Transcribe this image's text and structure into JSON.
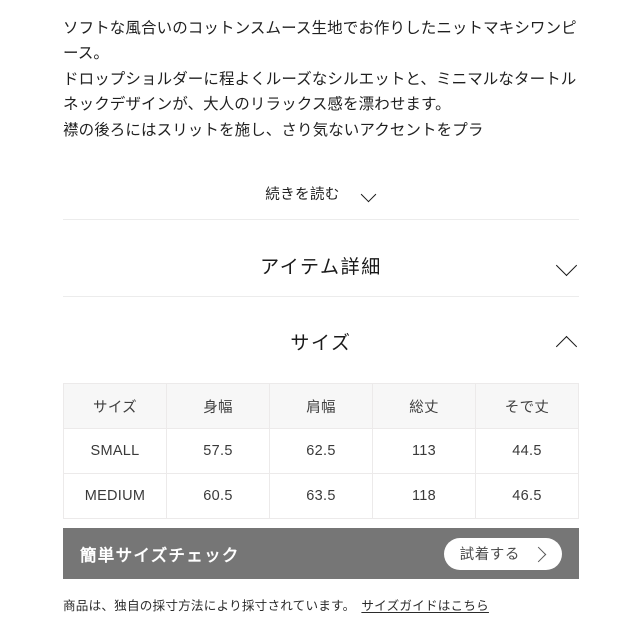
{
  "description": {
    "body": "ソフトな風合いのコットンスムース生地でお作りしたニットマキシワンピース。\nドロップショルダーに程よくルーズなシルエットと、ミニマルなタートルネックデザインが、大人のリラックス感を漂わせます。\n襟の後ろにはスリットを施し、さり気ないアクセントをプラ",
    "read_more_label": "続きを読む",
    "read_more_icon": "chevron-down-icon"
  },
  "accordions": [
    {
      "title": "アイテム詳細",
      "expanded": false,
      "icon": "chevron-down-icon"
    },
    {
      "title": "サイズ",
      "expanded": true,
      "icon": "chevron-up-icon"
    }
  ],
  "size_table": {
    "headers": [
      "サイズ",
      "身幅",
      "肩幅",
      "総丈",
      "そで丈"
    ],
    "rows": [
      [
        "SMALL",
        "57.5",
        "62.5",
        "113",
        "44.5"
      ],
      [
        "MEDIUM",
        "60.5",
        "63.5",
        "118",
        "46.5"
      ]
    ]
  },
  "cta_banner": {
    "title": "簡単サイズチェック",
    "button_label": "試着する",
    "button_icon": "chevron-right-icon",
    "background_color": "#767676",
    "button_background": "#ffffff"
  },
  "footnote": {
    "text": "商品は、独自の採寸方法により採寸されています。",
    "link_label": "サイズガイドはこちら"
  }
}
